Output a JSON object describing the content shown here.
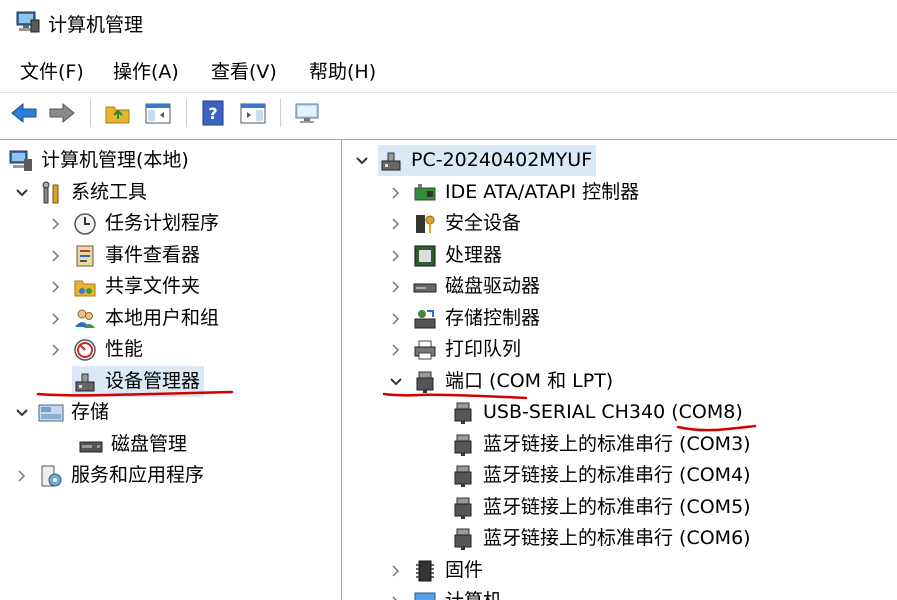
{
  "window": {
    "title": "计算机管理"
  },
  "menu": [
    "文件(F)",
    "操作(A)",
    "查看(V)",
    "帮助(H)"
  ],
  "toolbar": {
    "buttons": [
      "back-icon",
      "forward-icon",
      "up-folder-icon",
      "show-hide-tree-icon",
      "help-icon",
      "show-hide-action-pane-icon",
      "scan-hardware-icon"
    ]
  },
  "left_tree": {
    "root": "计算机管理(本地)",
    "system_tools": "系统工具",
    "task_scheduler": "任务计划程序",
    "event_viewer": "事件查看器",
    "shared_folders": "共享文件夹",
    "local_users_groups": "本地用户和组",
    "performance": "性能",
    "device_manager": "设备管理器",
    "storage": "存储",
    "disk_management": "磁盘管理",
    "services_apps": "服务和应用程序"
  },
  "right_tree": {
    "computer": "PC-20240402MYUF",
    "ide": "IDE ATA/ATAPI 控制器",
    "security": "安全设备",
    "processor": "处理器",
    "disk_drives": "磁盘驱动器",
    "storage_ctrl": "存储控制器",
    "print_queue": "打印队列",
    "ports": "端口 (COM 和 LPT)",
    "port_items": [
      "USB-SERIAL CH340 (COM8)",
      "蓝牙链接上的标准串行 (COM3)",
      "蓝牙链接上的标准串行 (COM4)",
      "蓝牙链接上的标准串行 (COM5)",
      "蓝牙链接上的标准串行 (COM6)"
    ],
    "firmware": "固件",
    "computer_cat": "计算机"
  },
  "colors": {
    "selection": "#dbe9f7",
    "annotation_red": "#d40000",
    "pane_border": "#a9a9a9"
  }
}
